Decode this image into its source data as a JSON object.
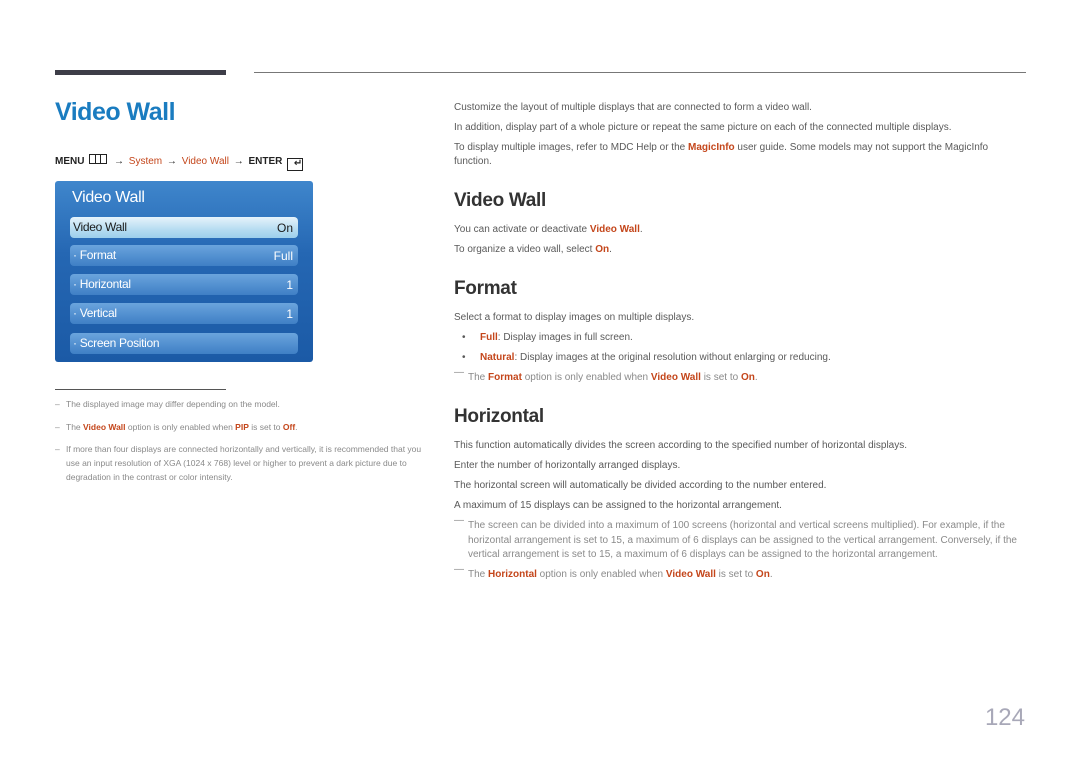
{
  "page_title": "Video Wall",
  "menu_path": {
    "menu": "MENU",
    "arrow": "→",
    "system": "System",
    "video_wall": "Video Wall",
    "enter": "ENTER",
    "enter_glyph": "↵"
  },
  "osd": {
    "title": "Video Wall",
    "items": [
      {
        "label": "Video Wall",
        "value": "On"
      },
      {
        "label": "· Format",
        "value": "Full"
      },
      {
        "label": "· Horizontal",
        "value": "1"
      },
      {
        "label": "· Vertical",
        "value": "1"
      },
      {
        "label": "· Screen Position",
        "value": ""
      }
    ]
  },
  "left_notes": {
    "dash": "–",
    "n1": "The displayed image may differ depending on the model.",
    "n2": {
      "pre": "The ",
      "vw": "Video Wall",
      "mid": " option is only enabled when ",
      "pip": "PIP",
      "mid2": " is set to ",
      "off": "Off",
      "post": "."
    },
    "n3": "If more than four displays are connected horizontally and vertically, it is recommended that you use an input resolution of XGA (1024 x 768) level or higher to prevent a dark picture due to degradation in the contrast or color intensity."
  },
  "intro": {
    "p1": "Customize the layout of multiple displays that are connected to form a video wall.",
    "p2": "In addition, display part of a whole picture or repeat the same picture on each of the connected multiple displays.",
    "p3": {
      "pre": "To display multiple images, refer to MDC Help or the ",
      "hl": "MagicInfo",
      "post": " user guide. Some models may not support the MagicInfo function."
    }
  },
  "sections": {
    "video_wall": {
      "heading": "Video Wall",
      "p1": {
        "pre": "You can activate or deactivate ",
        "hl": "Video Wall",
        "post": "."
      },
      "p2": {
        "pre": "To organize a video wall, select ",
        "hl": "On",
        "post": "."
      }
    },
    "format": {
      "heading": "Format",
      "p1": "Select a format to display images on multiple displays.",
      "bullet_glyph": "•",
      "b1": {
        "hl": "Full",
        "post": ": Display images in full screen."
      },
      "b2": {
        "hl": "Natural",
        "post": ": Display images at the original resolution without enlarging or reducing."
      },
      "note": {
        "pre": "The ",
        "hl1": "Format",
        "mid": " option is only enabled when ",
        "hl2": "Video Wall",
        "mid2": " is set to ",
        "hl3": "On",
        "post": "."
      }
    },
    "horizontal": {
      "heading": "Horizontal",
      "p1": "This function automatically divides the screen according to the specified number of horizontal displays.",
      "p2": "Enter the number of horizontally arranged displays.",
      "p3": "The horizontal screen will automatically be divided according to the number entered.",
      "p4": "A maximum of 15 displays can be assigned to the horizontal arrangement.",
      "note1": "The screen can be divided into a maximum of 100 screens (horizontal and vertical screens multiplied). For example, if the horizontal arrangement is set to 15, a maximum of 6 displays can be assigned to the vertical arrangement. Conversely, if the vertical arrangement is set to 15, a maximum of 6 displays can be assigned to the horizontal arrangement.",
      "note2": {
        "pre": "The ",
        "hl1": "Horizontal",
        "mid": " option is only enabled when ",
        "hl2": "Video Wall",
        "mid2": " is set to ",
        "hl3": "On",
        "post": "."
      }
    }
  },
  "note_dash": "—",
  "page_number": "124",
  "colors": {
    "title_blue": "#1a7cc0",
    "highlight": "#c4461b",
    "osd_blue": "#2567b3"
  }
}
